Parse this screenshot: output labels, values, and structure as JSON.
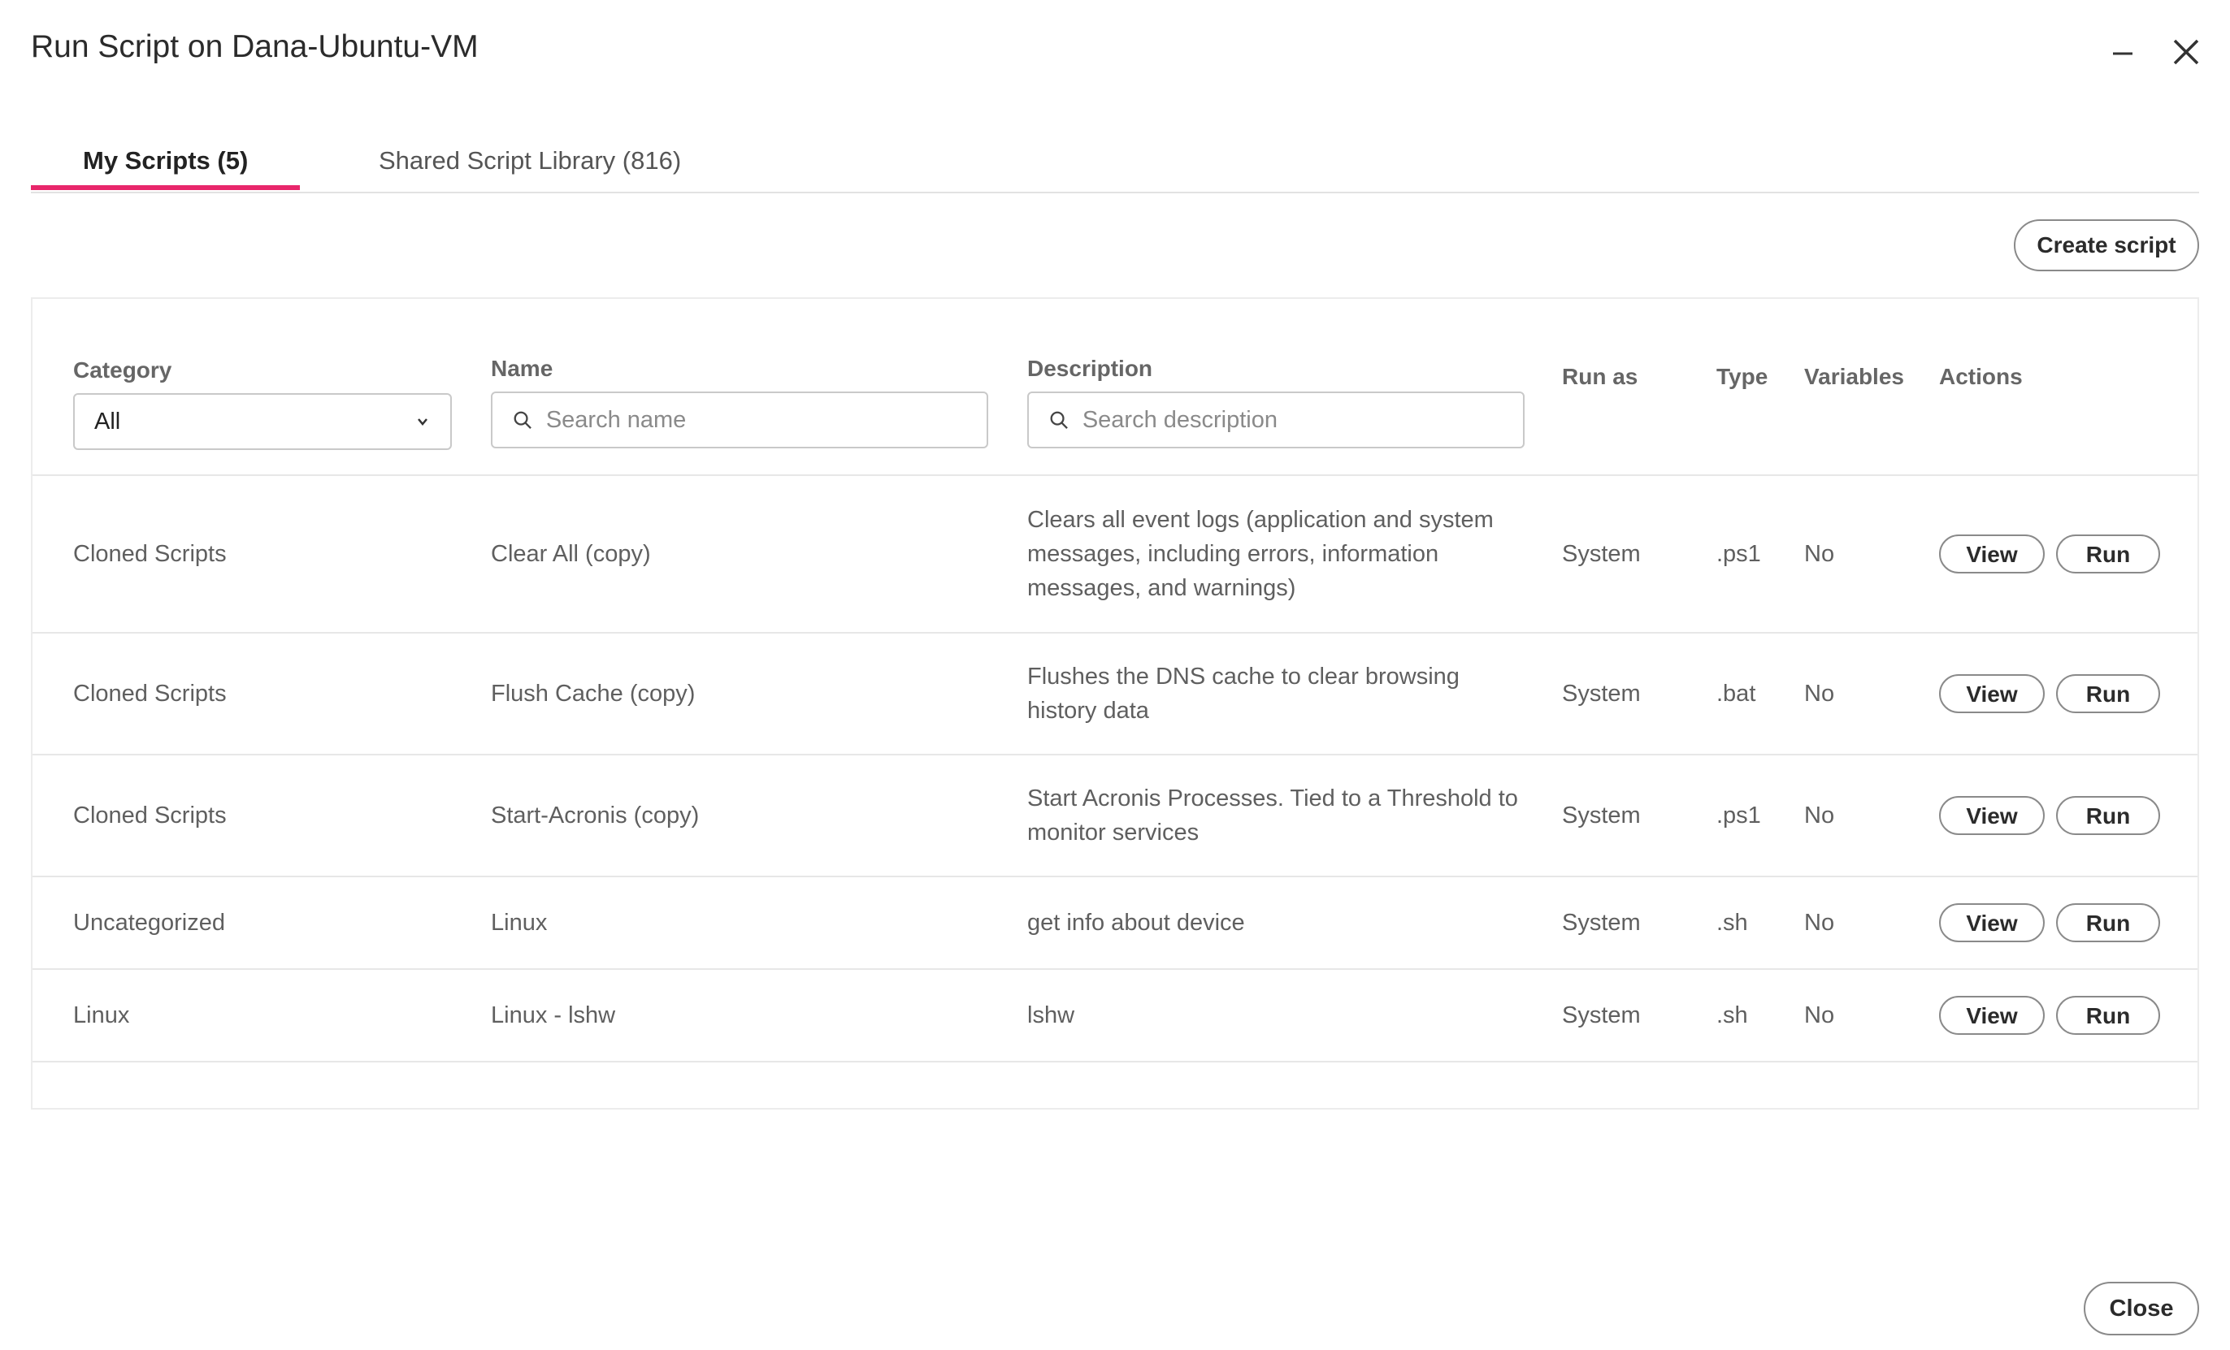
{
  "window": {
    "title": "Run Script on Dana-Ubuntu-VM"
  },
  "icons": {
    "minimize": "minimize-icon",
    "close": "close-icon",
    "search": "search-icon",
    "dropdown": "chevron-down-icon"
  },
  "colors": {
    "accent": "#e8266b"
  },
  "tabs": [
    {
      "label": "My Scripts (5)",
      "active": true
    },
    {
      "label": "Shared Script Library (816)",
      "active": false
    }
  ],
  "toolbar": {
    "create_label": "Create script"
  },
  "table": {
    "headers": {
      "category": "Category",
      "name": "Name",
      "description": "Description",
      "run_as": "Run as",
      "type": "Type",
      "variables": "Variables",
      "actions": "Actions"
    },
    "filters": {
      "category_value": "All",
      "name_placeholder": "Search name",
      "description_placeholder": "Search description"
    },
    "rows": [
      {
        "category": "Cloned Scripts",
        "name": "Clear All (copy)",
        "description": "Clears all event logs (application and system messages, including errors, information messages, and warnings)",
        "run_as": "System",
        "type": ".ps1",
        "variables": "No",
        "view": "View",
        "run": "Run"
      },
      {
        "category": "Cloned Scripts",
        "name": "Flush Cache (copy)",
        "description": "Flushes the DNS cache to clear browsing history data",
        "run_as": "System",
        "type": ".bat",
        "variables": "No",
        "view": "View",
        "run": "Run"
      },
      {
        "category": "Cloned Scripts",
        "name": "Start-Acronis (copy)",
        "description": "Start Acronis Processes. Tied to a Threshold to monitor services",
        "run_as": "System",
        "type": ".ps1",
        "variables": "No",
        "view": "View",
        "run": "Run"
      },
      {
        "category": "Uncategorized",
        "name": "Linux",
        "description": "get info about device",
        "run_as": "System",
        "type": ".sh",
        "variables": "No",
        "view": "View",
        "run": "Run"
      },
      {
        "category": "Linux",
        "name": "Linux - lshw",
        "description": "lshw",
        "run_as": "System",
        "type": ".sh",
        "variables": "No",
        "view": "View",
        "run": "Run"
      }
    ]
  },
  "footer": {
    "close_label": "Close"
  }
}
